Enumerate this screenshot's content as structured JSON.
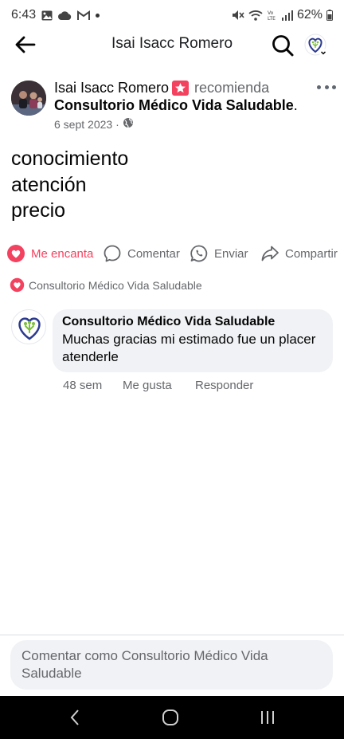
{
  "status_bar": {
    "time": "6:43",
    "battery": "62%"
  },
  "header": {
    "title": "Isai Isacc Romero",
    "icons": [
      "back-arrow-icon",
      "search-icon",
      "page-avatar-icon"
    ]
  },
  "post": {
    "author": "Isai Isacc Romero",
    "verb": "recomienda",
    "page": "Consultorio Médico Vida Saludable",
    "page_suffix": ".",
    "date": "6 sept 2023",
    "date_separator": "·",
    "lines": [
      "conocimiento",
      "atención",
      "precio"
    ]
  },
  "actions": {
    "love": "Me encanta",
    "comment": "Comentar",
    "send": "Enviar",
    "share": "Compartir"
  },
  "reactions": {
    "label": "Consultorio Médico Vida Saludable"
  },
  "comment": {
    "author": "Consultorio Médico Vida Saludable",
    "text": "Muchas gracias mi estimado fue un placer atenderle",
    "time": "48 sem",
    "like": "Me gusta",
    "reply": "Responder"
  },
  "composer": {
    "placeholder": "Comentar como Consultorio Médico Vida Saludable"
  },
  "colors": {
    "love_red": "#f3425f",
    "secondary_text": "#65676b",
    "bubble_bg": "#f0f2f5",
    "logo_blue": "#2b3a8f",
    "logo_green": "#7cbf3a"
  }
}
